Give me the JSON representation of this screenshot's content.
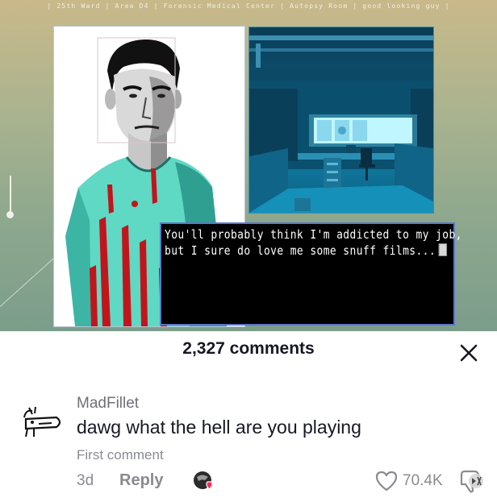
{
  "game": {
    "location": [
      "25th Ward",
      "Area D4",
      "Forensic Medical Center",
      "Autopsy Room",
      "good looking guy"
    ],
    "separator": "|",
    "dialogue": {
      "line1": "You'll probably think I'm addicted to my job,",
      "line2": "but I sure do love me some snuff films..."
    },
    "colors": {
      "scrubs": "#5fd8c4",
      "blood": "#c2151b",
      "room_glow": "#6fe6ff",
      "dialogue_border": "#5b78c8"
    }
  },
  "comments_sheet": {
    "title": "2,327 comments",
    "close_icon": "close-icon",
    "comment": {
      "username": "MadFillet",
      "text": "dawg what the hell are you playing",
      "badge": "First comment",
      "age": "3d",
      "reply_label": "Reply",
      "like_count": "70.4K",
      "icons": [
        "creator-liked-icon",
        "heart-outline-icon",
        "dislike-icon"
      ]
    }
  }
}
